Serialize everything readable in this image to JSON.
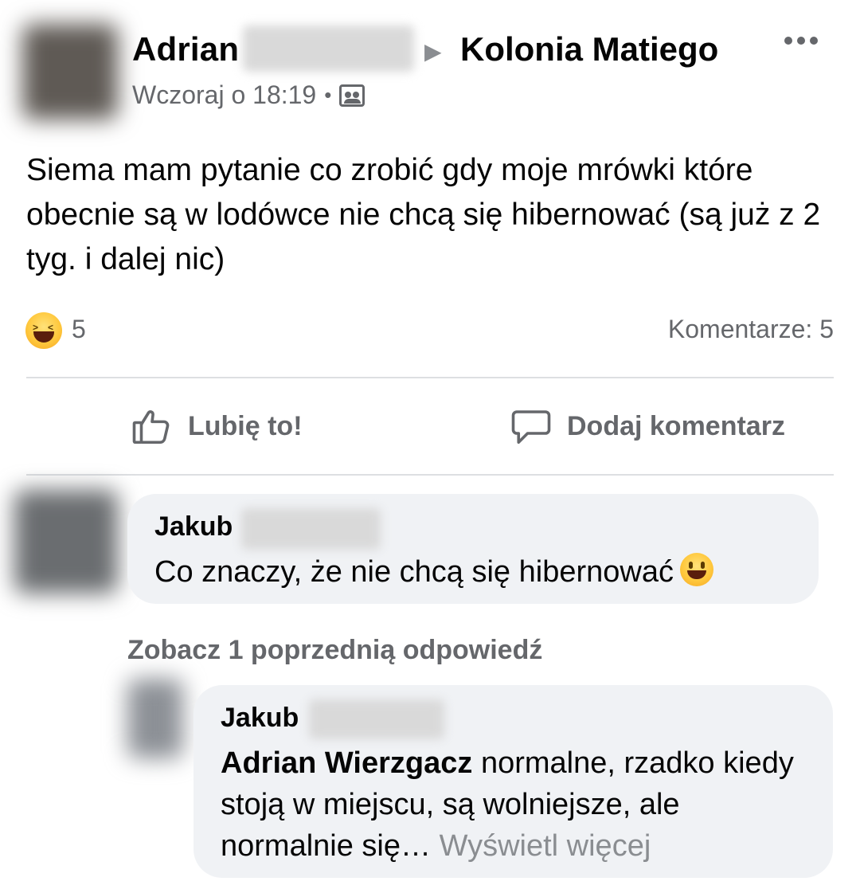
{
  "post": {
    "author": "Adrian",
    "arrow": "▶",
    "group": "Kolonia Matiego",
    "timestamp": "Wczoraj o 18:19",
    "separator": "•",
    "privacy_icon": "group-icon",
    "body": "Siema mam pytanie co zrobić gdy moje mrówki które obecnie są w lodówce nie chcą się hibernować (są już z 2 tyg. i dalej nic)",
    "reaction_icon": "haha-emoji",
    "reaction_count": "5",
    "comments_count": "Komentarze: 5"
  },
  "actions": {
    "like_label": "Lubię to!",
    "comment_label": "Dodaj komentarz"
  },
  "comments": [
    {
      "author": "Jakub",
      "text": "Co znaczy, że nie chcą się hibernować",
      "emoji": "smile-emoji"
    }
  ],
  "view_previous_replies": "Zobacz 1 poprzednią odpowiedź",
  "reply": {
    "author": "Jakub",
    "mention": "Adrian Wierzgacz",
    "text": " normalne, rzadko kiedy stoją w miejscu, są wolniejsze, ale normalnie się… ",
    "see_more": "Wyświetl więcej"
  }
}
